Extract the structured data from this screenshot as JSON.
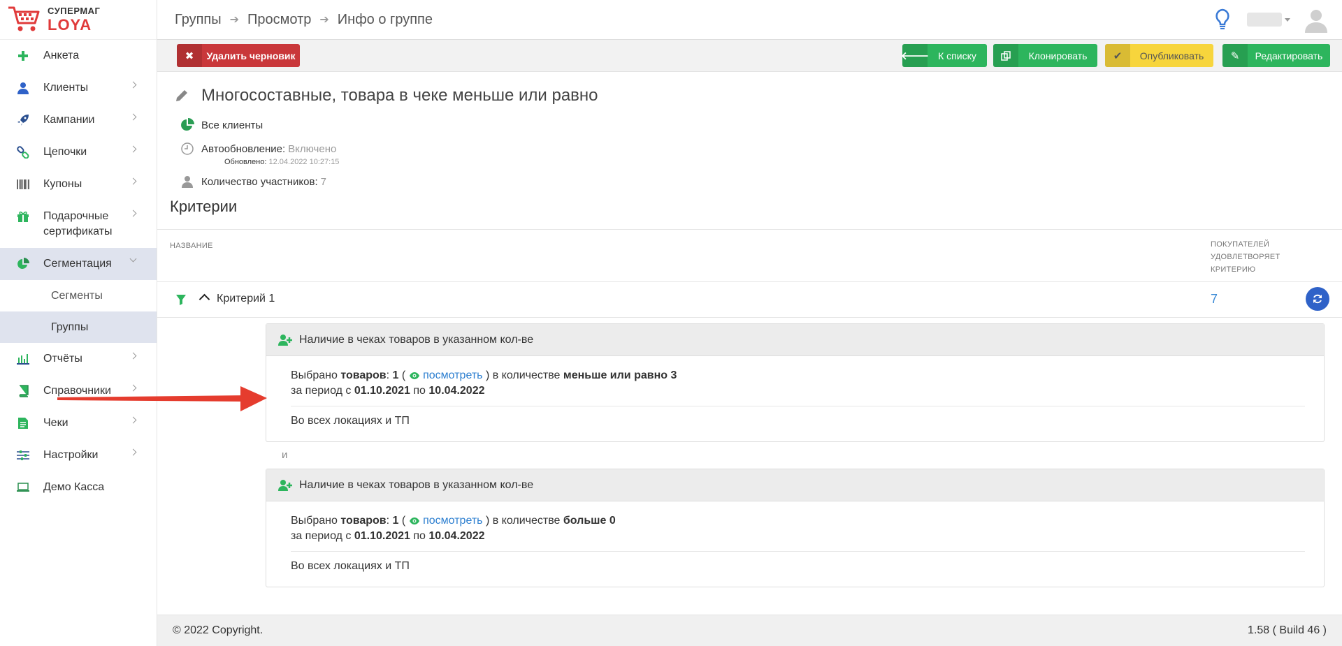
{
  "brand": {
    "line1": "СУПЕРМАГ",
    "line2": "LOYA"
  },
  "breadcrumbs": [
    "Группы",
    "Просмотр",
    "Инфо о группе"
  ],
  "sidebar": {
    "items": [
      {
        "label": "Анкета",
        "icon": "plus-icon"
      },
      {
        "label": "Клиенты",
        "icon": "user-icon"
      },
      {
        "label": "Кампании",
        "icon": "rocket-icon"
      },
      {
        "label": "Цепочки",
        "icon": "chain-icon"
      },
      {
        "label": "Купоны",
        "icon": "barcode-icon"
      },
      {
        "label": "Подарочные сертификаты",
        "icon": "gift-icon"
      },
      {
        "label": "Сегментация",
        "icon": "pie-chart-icon"
      },
      {
        "label": "Отчёты",
        "icon": "bar-chart-icon"
      },
      {
        "label": "Справочники",
        "icon": "book-icon"
      },
      {
        "label": "Чеки",
        "icon": "receipt-icon"
      },
      {
        "label": "Настройки",
        "icon": "sliders-icon"
      },
      {
        "label": "Демо Касса",
        "icon": "laptop-icon"
      }
    ],
    "sub": [
      "Сегменты",
      "Группы"
    ]
  },
  "toolbar": {
    "delete_draft": "Удалить черновик",
    "to_list": "К списку",
    "clone": "Клонировать",
    "publish": "Опубликовать",
    "edit": "Редактировать"
  },
  "group": {
    "title": "Многосоставные, товара в чеке меньше или равно",
    "audience": "Все клиенты",
    "autoupdate_label": "Автообновление:",
    "autoupdate_value": "Включено",
    "updated_label": "Обновлено:",
    "updated_value": "12.04.2022 10:27:15",
    "members_label": "Количество участников:",
    "members_value": "7"
  },
  "criteria": {
    "title": "Критерии",
    "col_name": "НАЗВАНИЕ",
    "col_buyers": "ПОКУПАТЕЛЕЙ УДОВЛЕТВОРЯЕТ КРИТЕРИЮ",
    "row_name": "Критерий 1",
    "row_count": "7",
    "and_label": "и",
    "conditions": [
      {
        "header": "Наличие в чеках товаров в указанном кол-ве",
        "selected": "Выбрано",
        "goods": "товаров",
        "goods_count": "1",
        "view_link": "посмотреть",
        "qty_text": ") в количестве",
        "qty_value": "меньше или равно 3",
        "period_text": "за период с",
        "date_from": "01.10.2021",
        "to_text": "по",
        "date_to": "10.04.2022",
        "locations": "Во всех локациях и ТП"
      },
      {
        "header": "Наличие в чеках товаров в указанном кол-ве",
        "selected": "Выбрано",
        "goods": "товаров",
        "goods_count": "1",
        "view_link": "посмотреть",
        "qty_text": ") в количестве",
        "qty_value": "больше 0",
        "period_text": "за период с",
        "date_from": "01.10.2021",
        "to_text": "по",
        "date_to": "10.04.2022",
        "locations": "Во всех локациях и ТП"
      }
    ]
  },
  "footer": {
    "copyright": "© 2022 Copyright.",
    "version": "1.58 ( Build 46 )"
  },
  "colors": {
    "green": "#2db55d",
    "red": "#c9373a",
    "yellow": "#f7d53c",
    "blue": "#2f62c8",
    "link": "#2d7fd0",
    "arrow": "#e53c2e"
  }
}
